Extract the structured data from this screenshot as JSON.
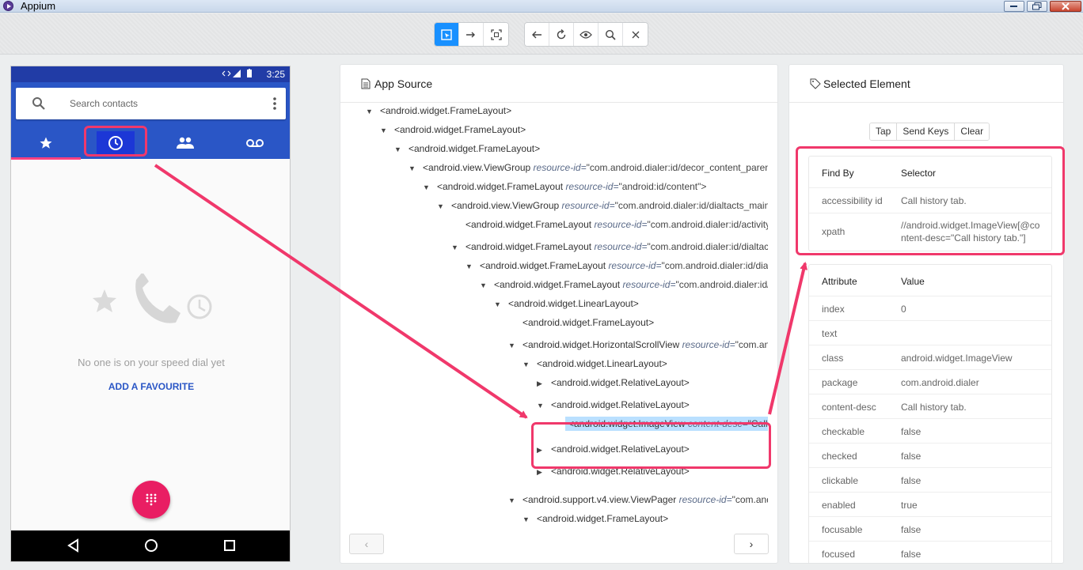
{
  "window": {
    "title": "Appium"
  },
  "toolbar": {
    "left_group": [
      "select-element-icon",
      "swipe-icon",
      "tap-coordinates-icon"
    ],
    "right_group": [
      "back-icon",
      "refresh-icon",
      "eye-icon",
      "search-icon",
      "close-icon"
    ]
  },
  "phone": {
    "status_time": "3:25",
    "search_placeholder": "Search contacts",
    "tabs": [
      "star-icon",
      "clock-icon",
      "people-icon",
      "voicemail-icon"
    ],
    "empty_message": "No one is on your speed dial yet",
    "add_favourite": "ADD A FAVOURITE",
    "nav": [
      "back-triangle-icon",
      "home-circle-icon",
      "recents-square-icon"
    ]
  },
  "source": {
    "title": "App Source",
    "nodes": [
      {
        "caret": "▼",
        "tag": "<android.widget.FrameLayout>",
        "attr": "",
        "val": ""
      },
      {
        "caret": "▼",
        "tag": "<android.widget.FrameLayout>",
        "attr": "",
        "val": ""
      },
      {
        "caret": "▼",
        "tag": "<android.widget.FrameLayout>",
        "attr": "",
        "val": ""
      },
      {
        "caret": "▼",
        "tag": "<android.view.ViewGroup",
        "attr": "resource-id=",
        "val": "\"com.android.dialer:id/decor_content_parent\">"
      },
      {
        "caret": "▼",
        "tag": "<android.widget.FrameLayout",
        "attr": "resource-id=",
        "val": "\"android:id/content\">"
      },
      {
        "caret": "▼",
        "tag": "<android.view.ViewGroup",
        "attr": "resource-id=",
        "val": "\"com.android.dialer:id/dialtacts_mainlayout\">"
      },
      {
        "caret": "",
        "tag": "<android.widget.FrameLayout",
        "attr": "resource-id=",
        "val": "\"com.android.dialer:id/activity_overlay\">"
      },
      {
        "caret": "▼",
        "tag": "<android.widget.FrameLayout",
        "attr": "resource-id=",
        "val": "\"com.android.dialer:id/dialtacts_container\">"
      },
      {
        "caret": "▼",
        "tag": "<android.widget.FrameLayout",
        "attr": "resource-id=",
        "val": "\"com.android.dialer:id/dialtacts_frame\">"
      },
      {
        "caret": "▼",
        "tag": "<android.widget.FrameLayout",
        "attr": "resource-id=",
        "val": "\"com.android.dialer:id/ic_list\">"
      },
      {
        "caret": "▼",
        "tag": "<android.widget.LinearLayout>",
        "attr": "",
        "val": ""
      },
      {
        "caret": "",
        "tag": "<android.widget.FrameLayout>",
        "attr": "",
        "val": ""
      },
      {
        "caret": "▼",
        "tag": "<android.widget.HorizontalScrollView",
        "attr": "resource-id=",
        "val": "\"com.android.dialer:id/lists_pager_header\">"
      },
      {
        "caret": "▼",
        "tag": "<android.widget.LinearLayout>",
        "attr": "",
        "val": ""
      },
      {
        "caret": "▶",
        "tag": "<android.widget.RelativeLayout>",
        "attr": "",
        "val": ""
      },
      {
        "caret": "▼",
        "tag": "<android.widget.RelativeLayout>",
        "attr": "",
        "val": ""
      },
      {
        "caret": "",
        "tag": "<android.widget.ImageView",
        "attr": "content-desc=",
        "val": "\"Call history tab.\">"
      },
      {
        "caret": "▶",
        "tag": "<android.widget.RelativeLayout>",
        "attr": "",
        "val": ""
      },
      {
        "caret": "▶",
        "tag": "<android.widget.RelativeLayout>",
        "attr": "",
        "val": ""
      },
      {
        "caret": "▼",
        "tag": "<android.support.v4.view.ViewPager",
        "attr": "resource-id=",
        "val": "\"com.android.dialer:id/lists_pager\">"
      },
      {
        "caret": "▼",
        "tag": "<android.widget.FrameLayout>",
        "attr": "",
        "val": ""
      }
    ]
  },
  "selected": {
    "title": "Selected Element",
    "buttons": [
      "Tap",
      "Send Keys",
      "Clear"
    ],
    "find_by_header": [
      "Find By",
      "Selector"
    ],
    "find_by": [
      [
        "accessibility id",
        "Call history tab."
      ],
      [
        "xpath",
        "//android.widget.ImageView[@content-desc=\"Call history tab.\"]"
      ]
    ],
    "attr_header": [
      "Attribute",
      "Value"
    ],
    "attributes": [
      [
        "index",
        "0"
      ],
      [
        "text",
        ""
      ],
      [
        "class",
        "android.widget.ImageView"
      ],
      [
        "package",
        "com.android.dialer"
      ],
      [
        "content-desc",
        "Call history tab."
      ],
      [
        "checkable",
        "false"
      ],
      [
        "checked",
        "false"
      ],
      [
        "clickable",
        "false"
      ],
      [
        "enabled",
        "true"
      ],
      [
        "focusable",
        "false"
      ],
      [
        "focused",
        "false"
      ]
    ]
  },
  "colors": {
    "accent": "#1890ff",
    "highlight": "#f0386b",
    "appbar": "#2a56c6",
    "fab": "#e91e63"
  }
}
